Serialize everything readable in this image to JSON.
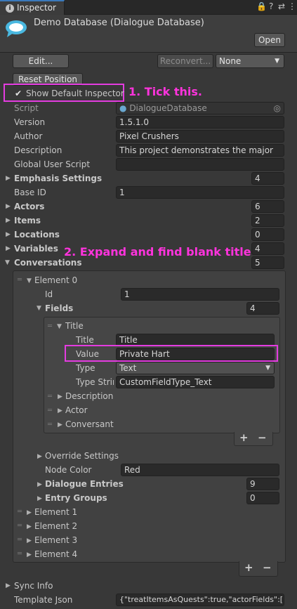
{
  "tab": {
    "label": "Inspector",
    "icon": "info-icon"
  },
  "header": {
    "title": "Demo Database (Dialogue Database)",
    "open_label": "Open",
    "icon": "dialogue-database-icon"
  },
  "toolbar": {
    "edit_label": "Edit...",
    "reconvert_label": "Reconvert...",
    "none_label": "None",
    "reset_label": "Reset Position",
    "show_default_label": "Show Default Inspector",
    "show_default_checked": true
  },
  "annotations": {
    "step1": "1. Tick this.",
    "step2": "2. Expand and find blank title"
  },
  "fields": {
    "script_label": "Script",
    "script_value": "DialogueDatabase",
    "version_label": "Version",
    "version_value": "1.5.1.0",
    "author_label": "Author",
    "author_value": "Pixel Crushers",
    "description_label": "Description",
    "description_value": "This project demonstrates the major",
    "global_user_script_label": "Global User Script",
    "global_user_script_value": "",
    "emphasis_label": "Emphasis Settings",
    "emphasis_value": "4",
    "base_id_label": "Base ID",
    "base_id_value": "1",
    "actors_label": "Actors",
    "actors_value": "6",
    "items_label": "Items",
    "items_value": "2",
    "locations_label": "Locations",
    "locations_value": "0",
    "variables_label": "Variables",
    "variables_value": "4",
    "conversations_label": "Conversations",
    "conversations_value": "5"
  },
  "conversation": {
    "element0_label": "Element 0",
    "id_label": "Id",
    "id_value": "1",
    "fields_label": "Fields",
    "fields_value": "4",
    "title_group": "Title",
    "title_label": "Title",
    "title_value": "Title",
    "value_label": "Value",
    "value_value": "Private Hart",
    "type_label": "Type",
    "type_value": "Text",
    "type_string_label": "Type Strir",
    "type_string_value": "CustomFieldType_Text",
    "description_item": "Description",
    "actor_item": "Actor",
    "conversant_item": "Conversant",
    "override_label": "Override Settings",
    "node_color_label": "Node Color",
    "node_color_value": "Red",
    "dialogue_entries_label": "Dialogue Entries",
    "dialogue_entries_value": "9",
    "entry_groups_label": "Entry Groups",
    "entry_groups_value": "0"
  },
  "elements": [
    "Element 1",
    "Element 2",
    "Element 3",
    "Element 4"
  ],
  "footer": {
    "sync_info_label": "Sync Info",
    "template_json_label": "Template Json",
    "template_json_value": "{\"treatItemsAsQuests\":true,\"actorFields\":[{"
  },
  "colors": {
    "accent": "#3a79bb",
    "annotation": "#ff33dd"
  }
}
